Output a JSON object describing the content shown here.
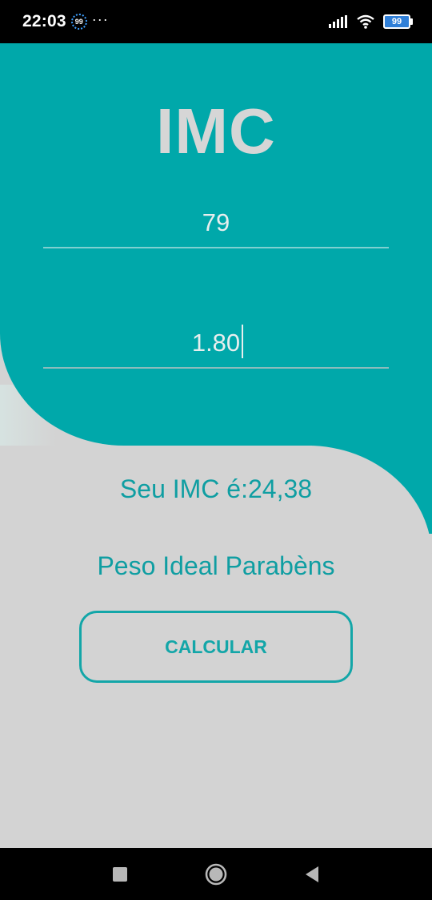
{
  "status_bar": {
    "time": "22:03",
    "notification_badge": "99",
    "more": "···",
    "battery_level": "99"
  },
  "app": {
    "title": "IMC",
    "weight_value": "79",
    "height_value": "1.80",
    "result_text": "Seu IMC é:24,38",
    "status_text": "Peso Ideal Parabèns",
    "calculate_label": "CALCULAR"
  },
  "colors": {
    "teal": "#00a8aa",
    "background": "#d3d3d3",
    "accent_text": "#0f9ea2"
  },
  "nav": {
    "icons": [
      "recent-apps-icon",
      "home-icon",
      "back-icon"
    ]
  }
}
